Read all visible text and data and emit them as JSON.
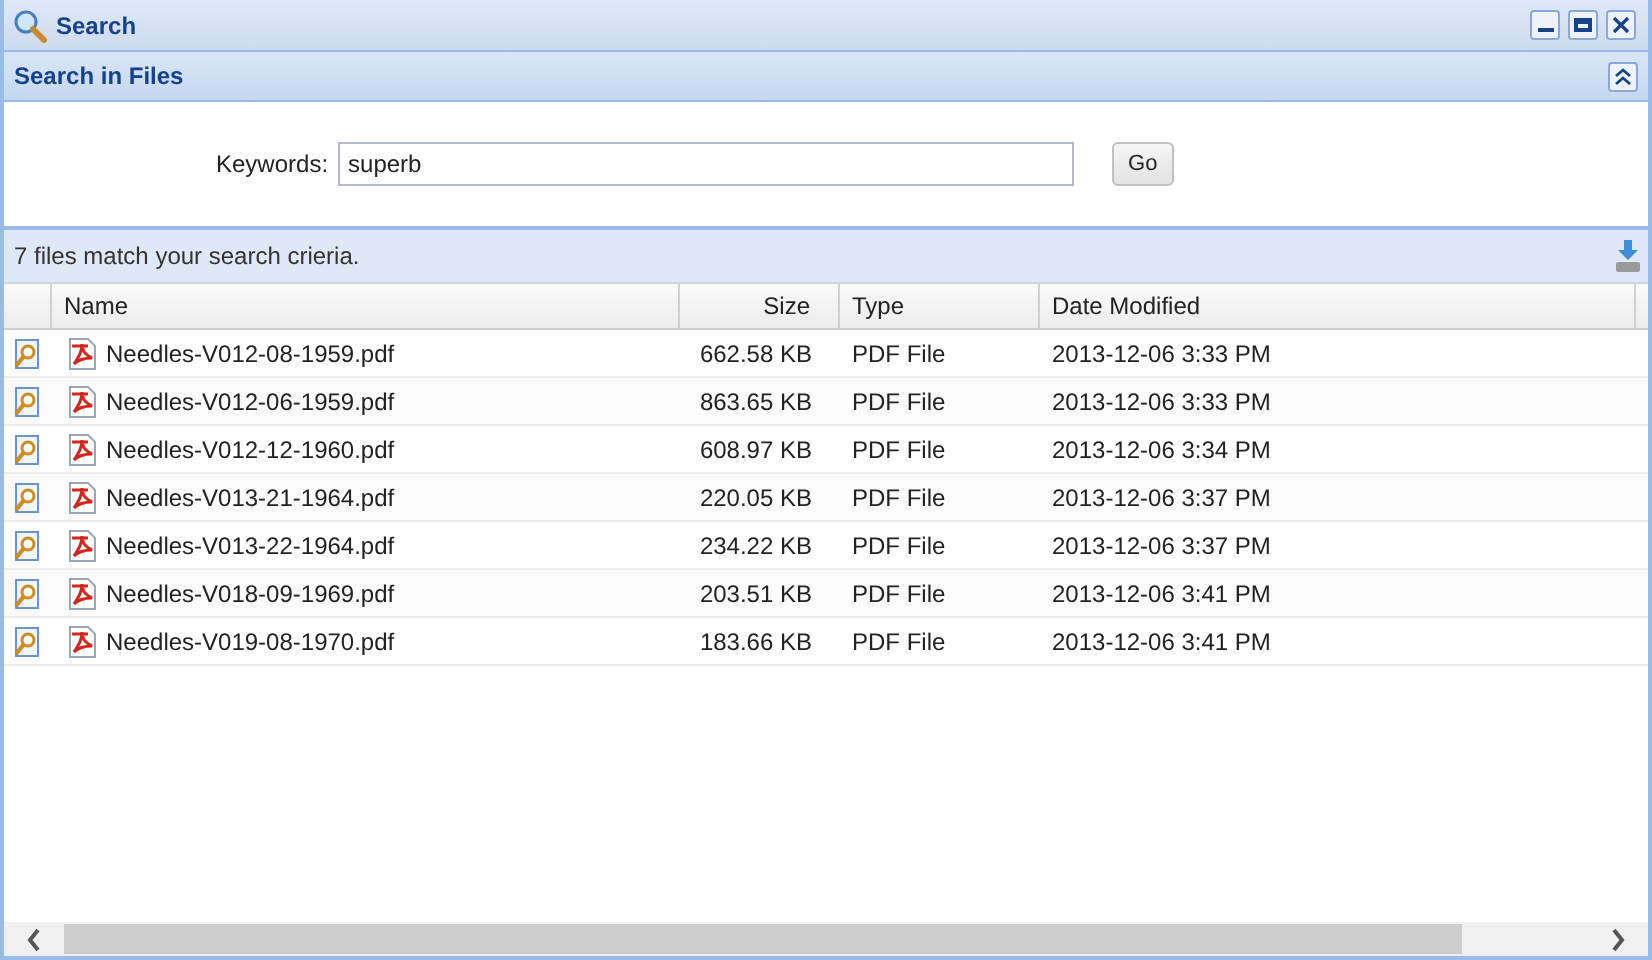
{
  "window": {
    "title": "Search"
  },
  "section": {
    "title": "Search in Files",
    "expanded": true
  },
  "form": {
    "label": "Keywords:",
    "value": "superb",
    "button": "Go"
  },
  "results": {
    "summary": "7 files match your search crieria."
  },
  "table": {
    "columns": [
      "Name",
      "Size",
      "Type",
      "Date Modified"
    ],
    "rows": [
      {
        "name": "Needles-V012-08-1959.pdf",
        "size": "662.58 KB",
        "type": "PDF File",
        "date": "2013-12-06 3:33 PM"
      },
      {
        "name": "Needles-V012-06-1959.pdf",
        "size": "863.65 KB",
        "type": "PDF File",
        "date": "2013-12-06 3:33 PM"
      },
      {
        "name": "Needles-V012-12-1960.pdf",
        "size": "608.97 KB",
        "type": "PDF File",
        "date": "2013-12-06 3:34 PM"
      },
      {
        "name": "Needles-V013-21-1964.pdf",
        "size": "220.05 KB",
        "type": "PDF File",
        "date": "2013-12-06 3:37 PM"
      },
      {
        "name": "Needles-V013-22-1964.pdf",
        "size": "234.22 KB",
        "type": "PDF File",
        "date": "2013-12-06 3:37 PM"
      },
      {
        "name": "Needles-V018-09-1969.pdf",
        "size": "203.51 KB",
        "type": "PDF File",
        "date": "2013-12-06 3:41 PM"
      },
      {
        "name": "Needles-V019-08-1970.pdf",
        "size": "183.66 KB",
        "type": "PDF File",
        "date": "2013-12-06 3:41 PM"
      }
    ]
  }
}
